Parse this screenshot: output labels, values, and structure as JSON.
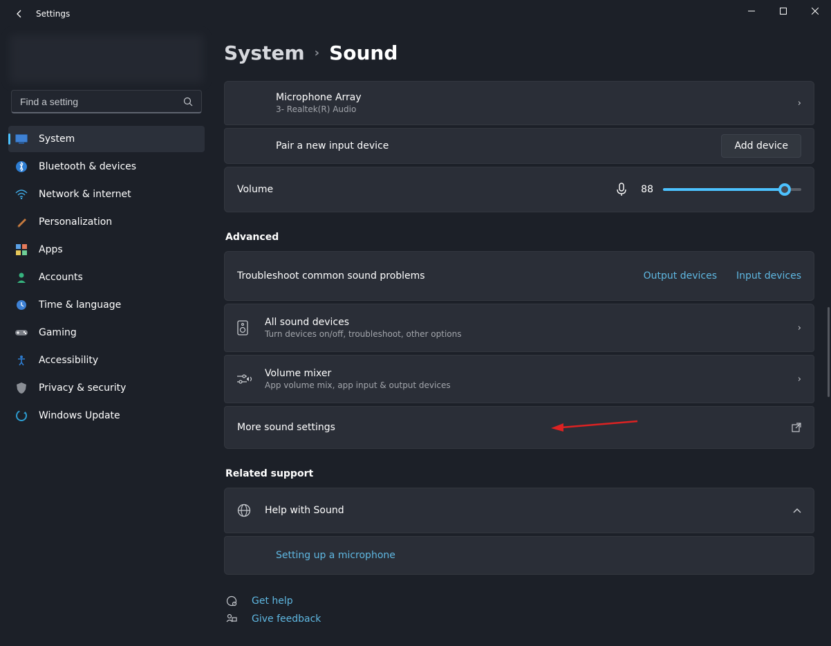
{
  "window": {
    "title": "Settings"
  },
  "search": {
    "placeholder": "Find a setting"
  },
  "nav": {
    "items": [
      {
        "key": "system",
        "label": "System"
      },
      {
        "key": "bluetooth",
        "label": "Bluetooth & devices"
      },
      {
        "key": "network",
        "label": "Network & internet"
      },
      {
        "key": "personalization",
        "label": "Personalization"
      },
      {
        "key": "apps",
        "label": "Apps"
      },
      {
        "key": "accounts",
        "label": "Accounts"
      },
      {
        "key": "time",
        "label": "Time & language"
      },
      {
        "key": "gaming",
        "label": "Gaming"
      },
      {
        "key": "accessibility",
        "label": "Accessibility"
      },
      {
        "key": "privacy",
        "label": "Privacy & security"
      },
      {
        "key": "update",
        "label": "Windows Update"
      }
    ]
  },
  "breadcrumb": {
    "parent": "System",
    "current": "Sound"
  },
  "input_device": {
    "name": "Microphone Array",
    "desc": "3- Realtek(R) Audio"
  },
  "pair": {
    "label": "Pair a new input device",
    "button": "Add device"
  },
  "volume": {
    "label": "Volume",
    "value": "88"
  },
  "sections": {
    "advanced": "Advanced",
    "related_support": "Related support"
  },
  "troubleshoot": {
    "label": "Troubleshoot common sound problems",
    "output": "Output devices",
    "input": "Input devices"
  },
  "all_devices": {
    "label": "All sound devices",
    "desc": "Turn devices on/off, troubleshoot, other options"
  },
  "mixer": {
    "label": "Volume mixer",
    "desc": "App volume mix, app input & output devices"
  },
  "more": {
    "label": "More sound settings"
  },
  "help_sound": {
    "label": "Help with Sound",
    "link1": "Setting up a microphone"
  },
  "footer": {
    "get_help": "Get help",
    "feedback": "Give feedback"
  }
}
